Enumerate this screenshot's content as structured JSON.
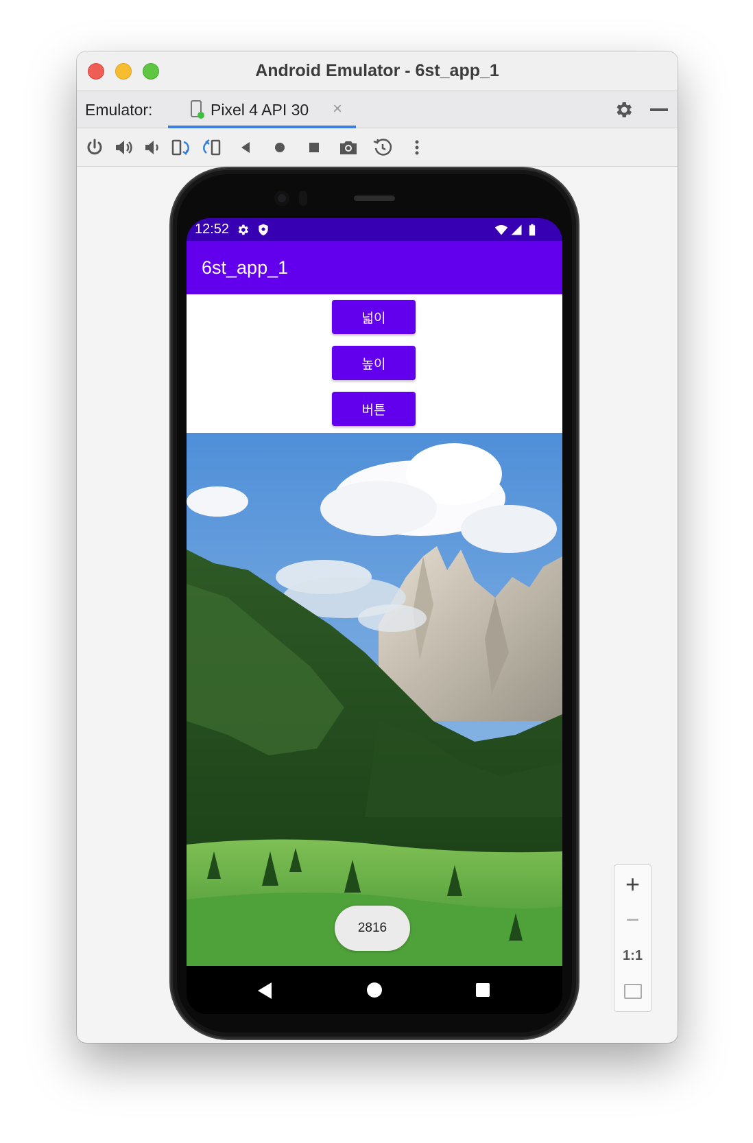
{
  "window": {
    "title": "Android Emulator - 6st_app_1"
  },
  "tabbar": {
    "emulator_label": "Emulator:",
    "tab_label": "Pixel 4 API 30",
    "tab_close": "×"
  },
  "toolbar": {
    "icons": [
      "power-icon",
      "volume-up-icon",
      "volume-down-icon",
      "rotate-left-icon",
      "rotate-right-icon",
      "back-icon",
      "home-icon",
      "overview-icon",
      "camera-icon",
      "snapshot-icon",
      "more-icon"
    ]
  },
  "device": {
    "status": {
      "time": "12:52"
    },
    "app_title": "6st_app_1",
    "buttons": {
      "width_label": "넓이",
      "height_label": "높이",
      "button_label": "버튼"
    },
    "toast": "2816"
  },
  "zoom": {
    "zoom_in": "+",
    "zoom_out": "−",
    "one_to_one": "1:1"
  },
  "colors": {
    "status_bar": "#3700b3",
    "app_bar": "#6200ee",
    "button": "#6200ee",
    "tab_underline": "#3d7ee0"
  }
}
